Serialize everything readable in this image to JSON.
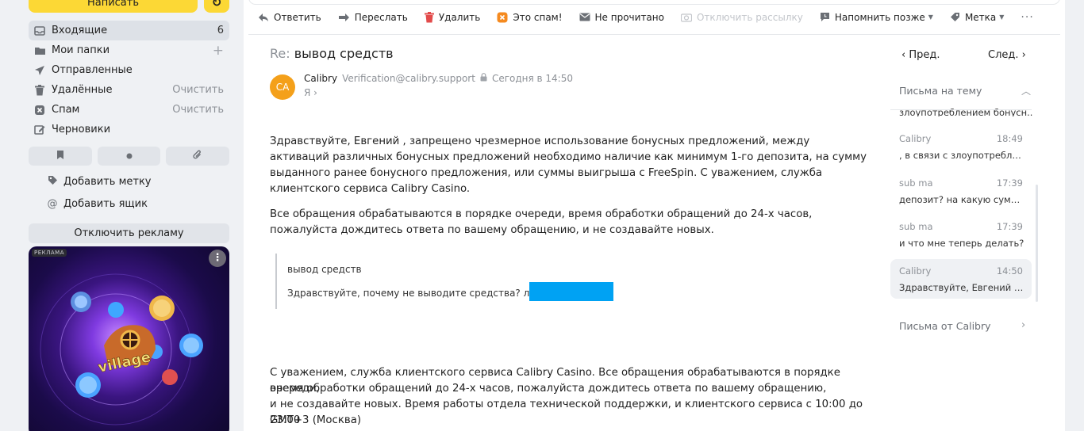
{
  "sidebar": {
    "compose_label": "Написать",
    "refresh_icon": "refresh-icon",
    "folders": [
      {
        "label": "Входящие",
        "count": "6",
        "icon": "inbox-icon",
        "active": true
      },
      {
        "label": "Мои папки",
        "icon": "folder-icon",
        "action": "+"
      },
      {
        "label": "Отправленные",
        "icon": "send-icon"
      },
      {
        "label": "Удалённые",
        "icon": "trash-icon",
        "action": "Очистить"
      },
      {
        "label": "Спам",
        "icon": "spam-icon",
        "action": "Очистить"
      },
      {
        "label": "Черновики",
        "icon": "draft-icon"
      }
    ],
    "filter_buttons": [
      "bookmark-icon",
      "dot-icon",
      "paperclip-icon"
    ],
    "add_label": "Добавить метку",
    "add_mailbox": "Добавить ящик",
    "disable_ads": "Отключить рекламу",
    "ad": {
      "badge": "РЕКЛАМА",
      "logo_text": "village"
    }
  },
  "toolbar": {
    "items": [
      {
        "label": "Ответить",
        "icon": "reply-icon"
      },
      {
        "label": "Переслать",
        "icon": "forward-icon"
      },
      {
        "label": "Удалить",
        "icon": "trash-icon"
      },
      {
        "label": "Это спам!",
        "icon": "spam-icon"
      },
      {
        "label": "Не прочитано",
        "icon": "envelope-icon"
      },
      {
        "label": "Отключить рассылку",
        "icon": "unsubscribe-icon",
        "disabled": true
      },
      {
        "label": "Напомнить позже",
        "icon": "reminder-icon",
        "dropdown": true
      },
      {
        "label": "Метка",
        "icon": "tag-icon",
        "dropdown": true
      }
    ],
    "more": "···"
  },
  "message": {
    "subject_prefix": "Re:",
    "subject": "вывод средств",
    "avatar_initials": "CA",
    "sender_name": "Calibry",
    "sender_email": "Verification@calibry.support",
    "date": "Сегодня в 14:50",
    "to": "Я",
    "paragraph1": "Здравствуйте, Евгений , запрещено чрезмерное использование бонусных предложений, между активаций различных бонусных предложений необходимо наличие как минимум 1-го депозита, на сумму выданного ранее бонусного предложения, или суммы выигрыша с FreeSpin. С уважением, служба клиентского сервиса Calibry Casino.",
    "paragraph2": "Все обращения обрабатываются в порядке очереди, время обработки обращений до 24-х часов, пожалуйста дождитесь ответа по вашему обращению, и не создавайте новых.",
    "quote_title": "вывод средств",
    "quote_text": "Здравствуйте, почему не выводите средства? логин",
    "signature_line1": "С уважением, служба клиентского сервиса Calibry Casino. Все обращения обрабатываются в порядке очереди,",
    "signature_line2": "время обработки обращений до 24-х часов, пожалуйста дождитесь ответа по вашему обращению,",
    "signature_line3": "и не создавайте новых. Время работы отдела технической поддержки, и клиентского сервиса с 10:00 до 23:00",
    "signature_line4": "GMT+3 (Москва)"
  },
  "thread": {
    "prev": "Пред.",
    "next": "След.",
    "title": "Письма на тему",
    "partial_snippet": "злоупотреблением бонусн...",
    "items": [
      {
        "sender": "Calibry",
        "time": "18:49",
        "snippet": ", в связи с злоупотреблени..."
      },
      {
        "sender": "sub ma",
        "time": "17:39",
        "snippet": "депозит? на какую сумму? ..."
      },
      {
        "sender": "sub ma",
        "time": "17:39",
        "snippet": "и что мне теперь делать?"
      },
      {
        "sender": "Calibry",
        "time": "14:50",
        "snippet": "Здравствуйте, Евгений , за...",
        "active": true
      }
    ],
    "from_link": "Письма от Calibry"
  }
}
